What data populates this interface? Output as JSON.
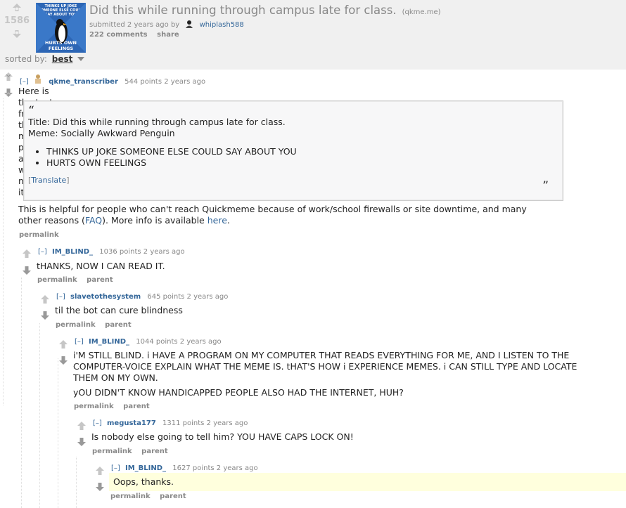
{
  "post": {
    "score": "1586",
    "title": "Did this while running through campus late for class.",
    "domain": "(qkme.me)",
    "submitted_text": "submitted 2 years ago by",
    "author": "whiplash588",
    "comments_label": "222 comments",
    "share_label": "share",
    "thumb_top_text": "THINKS UP JOKE SOMEONE ELSE COULD SAY ABOUT YOU",
    "thumb_bottom_text": "HURTS OWN FEELINGS"
  },
  "sort": {
    "label": "sorted by:",
    "value": "best"
  },
  "comments": [
    {
      "expand": "[–]",
      "author": "qkme_transcriber",
      "points": "544 points",
      "age": "2 years ago",
      "text": "Here is the text from this meme pic for anybody who needs it:",
      "quote": {
        "open_mark": "“",
        "close_mark": "”",
        "title_line": "Title: Did this while running through campus late for class.",
        "meme_line": "Meme: Socially Awkward Penguin",
        "items": [
          "THINKS UP JOKE SOMEONE ELSE COULD SAY ABOUT YOU",
          "HURTS OWN FEELINGS"
        ],
        "translate_open": "[",
        "translate_label": "Translate",
        "translate_close": "]"
      },
      "footer_text_1": "This is helpful for people who can't reach Quickmeme because of work/school firewalls or site downtime, and many",
      "footer_text_2a": "other reasons (",
      "footer_faq": "FAQ",
      "footer_text_2b": "). More info is available ",
      "footer_here": "here",
      "footer_text_2c": ".",
      "permalink": "permalink"
    },
    {
      "expand": "[–]",
      "author": "IM_BLIND_",
      "points": "1036 points",
      "age": "2 years ago",
      "text": "tHANKS, NOW I CAN READ IT.",
      "permalink": "permalink",
      "parent": "parent"
    },
    {
      "expand": "[–]",
      "author": "slavetothesystem",
      "points": "645 points",
      "age": "2 years ago",
      "text": "til the bot can cure blindness",
      "permalink": "permalink",
      "parent": "parent"
    },
    {
      "expand": "[–]",
      "author": "IM_BLIND_",
      "points": "1044 points",
      "age": "2 years ago",
      "text_lines": [
        "i'M STILL BLIND. i HAVE A PROGRAM ON MY COMPUTER THAT READS EVERYTHING FOR ME, AND I LISTEN TO THE",
        "COMPUTER-VOICE EXPLAIN WHAT THE MEME IS. tHAT'S HOW i EXPERIENCE MEMES. i CAN STILL TYPE AND LOCATE",
        "THEM ON MY OWN."
      ],
      "text2": "yOU DIDN'T KNOW HANDICAPPED PEOPLE ALSO HAD THE INTERNET, HUH?",
      "permalink": "permalink",
      "parent": "parent"
    },
    {
      "expand": "[–]",
      "author": "megusta177",
      "points": "1311 points",
      "age": "2 years ago",
      "text": "Is nobody else going to tell him? YOU HAVE CAPS LOCK ON!",
      "permalink": "permalink",
      "parent": "parent"
    },
    {
      "expand": "[–]",
      "author": "IM_BLIND_",
      "points": "1627 points",
      "age": "2 years ago",
      "text": "Oops, thanks.",
      "permalink": "permalink",
      "parent": "parent"
    }
  ],
  "colors": {
    "link": "#336699",
    "meta": "#888888",
    "highlight": "#ffffdd",
    "header_bg": "#f0f0f0"
  }
}
